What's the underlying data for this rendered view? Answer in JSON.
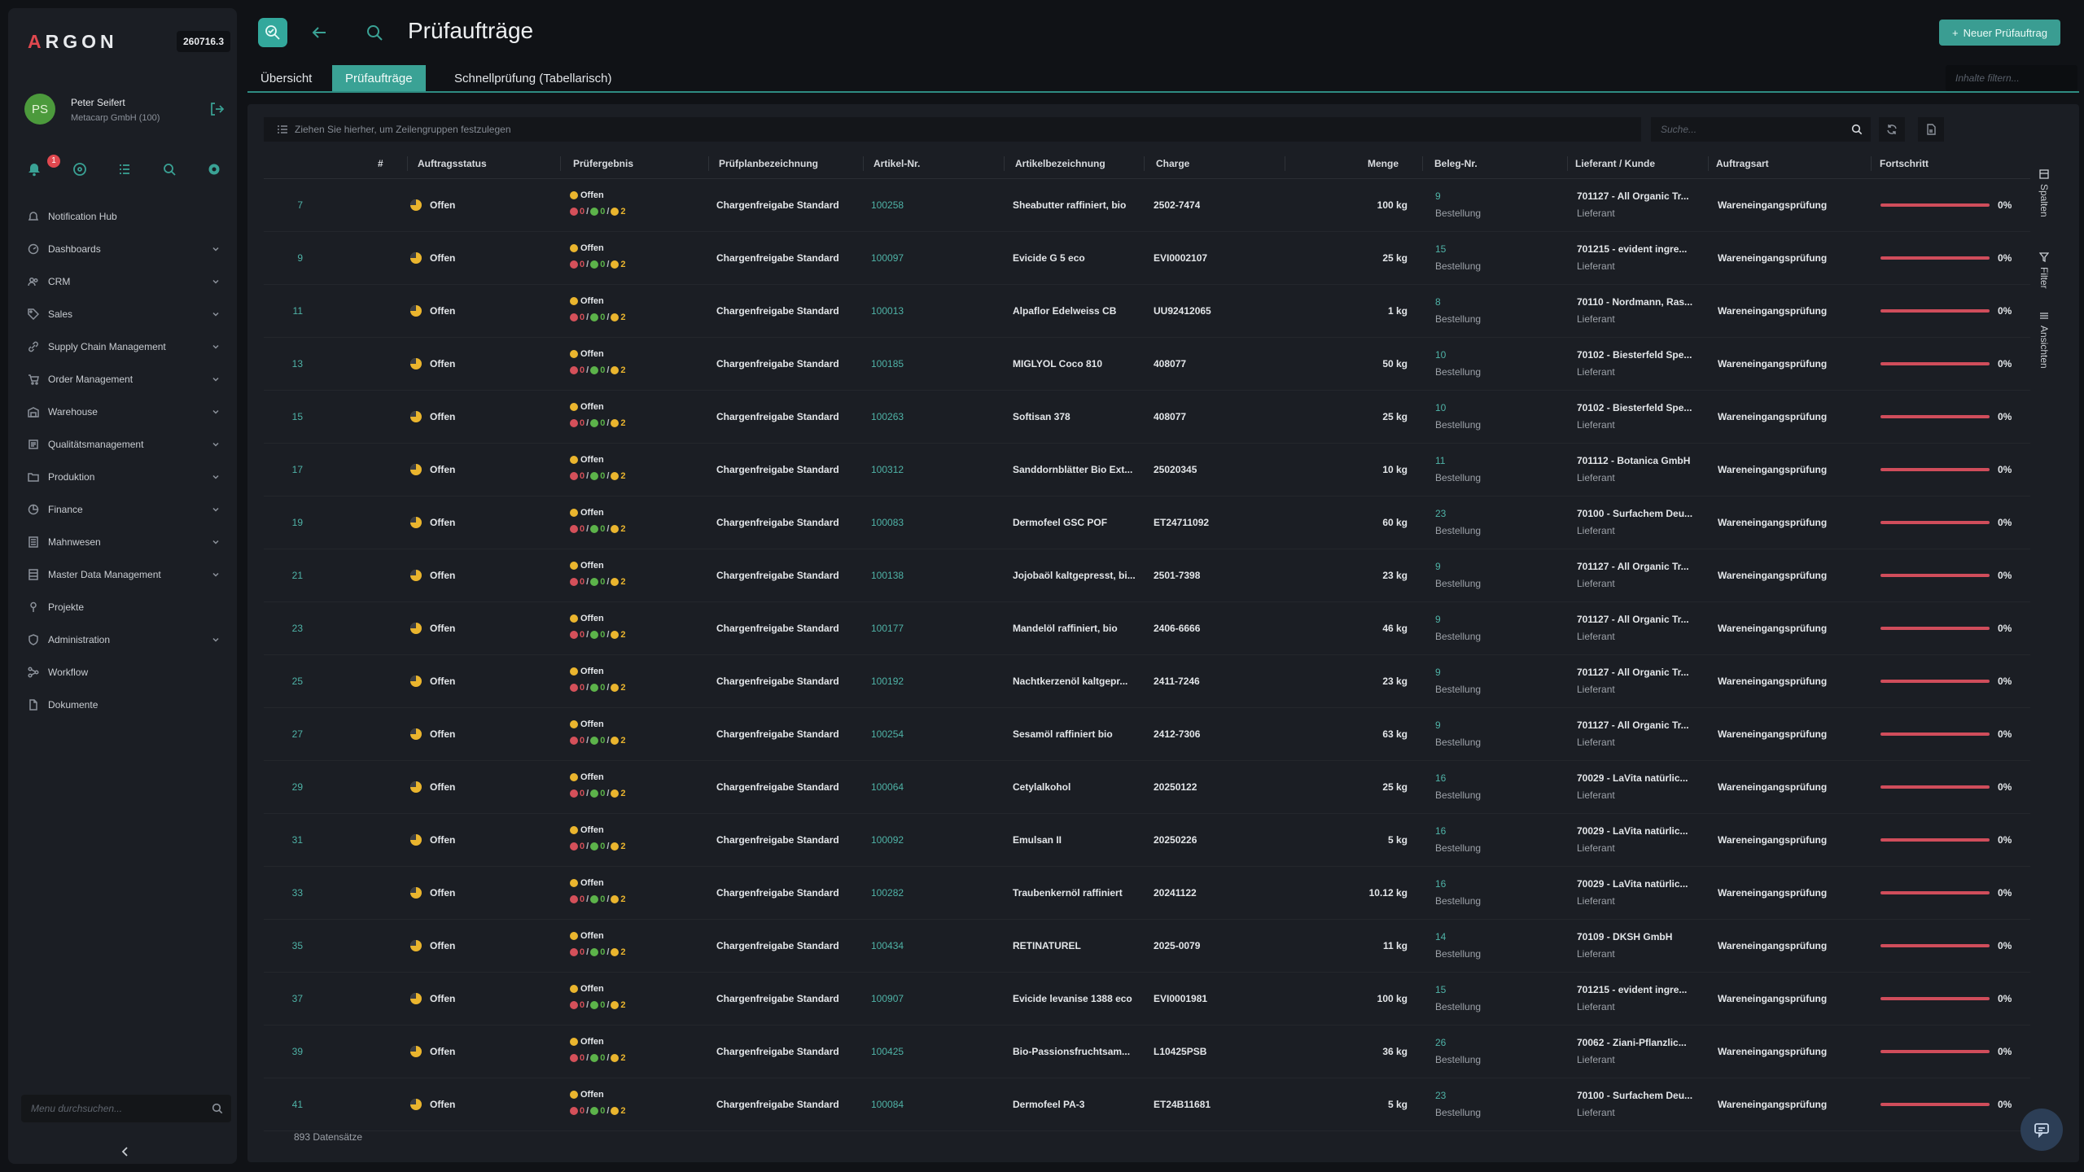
{
  "sidebar": {
    "logo": "RGON",
    "logo_a": "A",
    "version": "260716.3",
    "user": {
      "initials": "PS",
      "name": "Peter Seifert",
      "company": "Metacarp GmbH (100)"
    },
    "notification_count": "1",
    "items": [
      {
        "label": "Notification Hub",
        "icon": "bell-icon",
        "chevron": false
      },
      {
        "label": "Dashboards",
        "icon": "dashboard-icon",
        "chevron": true
      },
      {
        "label": "CRM",
        "icon": "users-icon",
        "chevron": true
      },
      {
        "label": "Sales",
        "icon": "tag-icon",
        "chevron": true
      },
      {
        "label": "Supply Chain Management",
        "icon": "link-icon",
        "chevron": true
      },
      {
        "label": "Order Management",
        "icon": "cart-icon",
        "chevron": true
      },
      {
        "label": "Warehouse",
        "icon": "warehouse-icon",
        "chevron": true
      },
      {
        "label": "Qualitätsmanagement",
        "icon": "quality-icon",
        "chevron": true
      },
      {
        "label": "Produktion",
        "icon": "folder-icon",
        "chevron": true
      },
      {
        "label": "Finance",
        "icon": "finance-icon",
        "chevron": true
      },
      {
        "label": "Mahnwesen",
        "icon": "archive-icon",
        "chevron": true
      },
      {
        "label": "Master Data Management",
        "icon": "database-icon",
        "chevron": true
      },
      {
        "label": "Projekte",
        "icon": "pin-icon",
        "chevron": false
      },
      {
        "label": "Administration",
        "icon": "shield-icon",
        "chevron": true
      },
      {
        "label": "Workflow",
        "icon": "workflow-icon",
        "chevron": false
      },
      {
        "label": "Dokumente",
        "icon": "document-icon",
        "chevron": false
      }
    ],
    "menu_search_placeholder": "Menu durchsuchen..."
  },
  "header": {
    "title": "Prüfaufträge",
    "new_button": "Neuer Prüfauftrag"
  },
  "tabs": [
    {
      "label": "Übersicht",
      "active": false
    },
    {
      "label": "Prüfaufträge",
      "active": true
    },
    {
      "label": "Schnellprüfung (Tabellarisch)",
      "active": false
    }
  ],
  "filter_placeholder": "Inhalte filtern...",
  "grid": {
    "group_hint": "Ziehen Sie hierher, um Zeilengruppen festzulegen",
    "search_placeholder": "Suche...",
    "columns": [
      "#",
      "Auftragsstatus",
      "Prüfergebnis",
      "Prüfplanbezeichnung",
      "Artikel-Nr.",
      "Artikelbezeichnung",
      "Charge",
      "Menge",
      "Beleg-Nr.",
      "Lieferant / Kunde",
      "Auftragsart",
      "Fortschritt"
    ],
    "side_tools": [
      "Spalten",
      "Filter",
      "Ansichten"
    ],
    "record_count": "893 Datensätze",
    "rows": [
      {
        "num": "7",
        "status": "Offen",
        "result": "Offen",
        "r": "0",
        "g": "0",
        "y": "2",
        "plan": "Chargenfreigabe Standard",
        "art": "100258",
        "artname": "Sheabutter raffiniert, bio",
        "charge": "2502-7474",
        "menge": "100 kg",
        "beleg": "9",
        "belegtype": "Bestellung",
        "lief": "701127 - All Organic Tr...",
        "lieftype": "Lieferant",
        "auftragsart": "Wareneingangsprüfung",
        "progress": "0%"
      },
      {
        "num": "9",
        "status": "Offen",
        "result": "Offen",
        "r": "0",
        "g": "0",
        "y": "2",
        "plan": "Chargenfreigabe Standard",
        "art": "100097",
        "artname": "Evicide G 5 eco",
        "charge": "EVI0002107",
        "menge": "25 kg",
        "beleg": "15",
        "belegtype": "Bestellung",
        "lief": "701215 - evident ingre...",
        "lieftype": "Lieferant",
        "auftragsart": "Wareneingangsprüfung",
        "progress": "0%"
      },
      {
        "num": "11",
        "status": "Offen",
        "result": "Offen",
        "r": "0",
        "g": "0",
        "y": "2",
        "plan": "Chargenfreigabe Standard",
        "art": "100013",
        "artname": "Alpaflor Edelweiss CB",
        "charge": "UU92412065",
        "menge": "1 kg",
        "beleg": "8",
        "belegtype": "Bestellung",
        "lief": "70110 - Nordmann, Ras...",
        "lieftype": "Lieferant",
        "auftragsart": "Wareneingangsprüfung",
        "progress": "0%"
      },
      {
        "num": "13",
        "status": "Offen",
        "result": "Offen",
        "r": "0",
        "g": "0",
        "y": "2",
        "plan": "Chargenfreigabe Standard",
        "art": "100185",
        "artname": "MIGLYOL Coco 810",
        "charge": "408077",
        "menge": "50 kg",
        "beleg": "10",
        "belegtype": "Bestellung",
        "lief": "70102 - Biesterfeld Spe...",
        "lieftype": "Lieferant",
        "auftragsart": "Wareneingangsprüfung",
        "progress": "0%"
      },
      {
        "num": "15",
        "status": "Offen",
        "result": "Offen",
        "r": "0",
        "g": "0",
        "y": "2",
        "plan": "Chargenfreigabe Standard",
        "art": "100263",
        "artname": "Softisan 378",
        "charge": "408077",
        "menge": "25 kg",
        "beleg": "10",
        "belegtype": "Bestellung",
        "lief": "70102 - Biesterfeld Spe...",
        "lieftype": "Lieferant",
        "auftragsart": "Wareneingangsprüfung",
        "progress": "0%"
      },
      {
        "num": "17",
        "status": "Offen",
        "result": "Offen",
        "r": "0",
        "g": "0",
        "y": "2",
        "plan": "Chargenfreigabe Standard",
        "art": "100312",
        "artname": "Sanddornblätter Bio Ext...",
        "charge": "25020345",
        "menge": "10 kg",
        "beleg": "11",
        "belegtype": "Bestellung",
        "lief": "701112 - Botanica GmbH",
        "lieftype": "Lieferant",
        "auftragsart": "Wareneingangsprüfung",
        "progress": "0%"
      },
      {
        "num": "19",
        "status": "Offen",
        "result": "Offen",
        "r": "0",
        "g": "0",
        "y": "2",
        "plan": "Chargenfreigabe Standard",
        "art": "100083",
        "artname": "Dermofeel GSC POF",
        "charge": "ET24711092",
        "menge": "60 kg",
        "beleg": "23",
        "belegtype": "Bestellung",
        "lief": "70100 - Surfachem Deu...",
        "lieftype": "Lieferant",
        "auftragsart": "Wareneingangsprüfung",
        "progress": "0%"
      },
      {
        "num": "21",
        "status": "Offen",
        "result": "Offen",
        "r": "0",
        "g": "0",
        "y": "2",
        "plan": "Chargenfreigabe Standard",
        "art": "100138",
        "artname": "Jojobaöl kaltgepresst, bi...",
        "charge": "2501-7398",
        "menge": "23 kg",
        "beleg": "9",
        "belegtype": "Bestellung",
        "lief": "701127 - All Organic Tr...",
        "lieftype": "Lieferant",
        "auftragsart": "Wareneingangsprüfung",
        "progress": "0%"
      },
      {
        "num": "23",
        "status": "Offen",
        "result": "Offen",
        "r": "0",
        "g": "0",
        "y": "2",
        "plan": "Chargenfreigabe Standard",
        "art": "100177",
        "artname": "Mandelöl raffiniert, bio",
        "charge": "2406-6666",
        "menge": "46 kg",
        "beleg": "9",
        "belegtype": "Bestellung",
        "lief": "701127 - All Organic Tr...",
        "lieftype": "Lieferant",
        "auftragsart": "Wareneingangsprüfung",
        "progress": "0%"
      },
      {
        "num": "25",
        "status": "Offen",
        "result": "Offen",
        "r": "0",
        "g": "0",
        "y": "2",
        "plan": "Chargenfreigabe Standard",
        "art": "100192",
        "artname": "Nachtkerzenöl kaltgepr...",
        "charge": "2411-7246",
        "menge": "23 kg",
        "beleg": "9",
        "belegtype": "Bestellung",
        "lief": "701127 - All Organic Tr...",
        "lieftype": "Lieferant",
        "auftragsart": "Wareneingangsprüfung",
        "progress": "0%"
      },
      {
        "num": "27",
        "status": "Offen",
        "result": "Offen",
        "r": "0",
        "g": "0",
        "y": "2",
        "plan": "Chargenfreigabe Standard",
        "art": "100254",
        "artname": "Sesamöl raffiniert bio",
        "charge": "2412-7306",
        "menge": "63 kg",
        "beleg": "9",
        "belegtype": "Bestellung",
        "lief": "701127 - All Organic Tr...",
        "lieftype": "Lieferant",
        "auftragsart": "Wareneingangsprüfung",
        "progress": "0%"
      },
      {
        "num": "29",
        "status": "Offen",
        "result": "Offen",
        "r": "0",
        "g": "0",
        "y": "2",
        "plan": "Chargenfreigabe Standard",
        "art": "100064",
        "artname": "Cetylalkohol",
        "charge": "20250122",
        "menge": "25 kg",
        "beleg": "16",
        "belegtype": "Bestellung",
        "lief": "70029 - LaVita natürlic...",
        "lieftype": "Lieferant",
        "auftragsart": "Wareneingangsprüfung",
        "progress": "0%"
      },
      {
        "num": "31",
        "status": "Offen",
        "result": "Offen",
        "r": "0",
        "g": "0",
        "y": "2",
        "plan": "Chargenfreigabe Standard",
        "art": "100092",
        "artname": "Emulsan II",
        "charge": "20250226",
        "menge": "5 kg",
        "beleg": "16",
        "belegtype": "Bestellung",
        "lief": "70029 - LaVita natürlic...",
        "lieftype": "Lieferant",
        "auftragsart": "Wareneingangsprüfung",
        "progress": "0%"
      },
      {
        "num": "33",
        "status": "Offen",
        "result": "Offen",
        "r": "0",
        "g": "0",
        "y": "2",
        "plan": "Chargenfreigabe Standard",
        "art": "100282",
        "artname": "Traubenkernöl raffiniert",
        "charge": "20241122",
        "menge": "10.12 kg",
        "beleg": "16",
        "belegtype": "Bestellung",
        "lief": "70029 - LaVita natürlic...",
        "lieftype": "Lieferant",
        "auftragsart": "Wareneingangsprüfung",
        "progress": "0%"
      },
      {
        "num": "35",
        "status": "Offen",
        "result": "Offen",
        "r": "0",
        "g": "0",
        "y": "2",
        "plan": "Chargenfreigabe Standard",
        "art": "100434",
        "artname": "RETINATUREL",
        "charge": "2025-0079",
        "menge": "11 kg",
        "beleg": "14",
        "belegtype": "Bestellung",
        "lief": "70109 - DKSH GmbH",
        "lieftype": "Lieferant",
        "auftragsart": "Wareneingangsprüfung",
        "progress": "0%"
      },
      {
        "num": "37",
        "status": "Offen",
        "result": "Offen",
        "r": "0",
        "g": "0",
        "y": "2",
        "plan": "Chargenfreigabe Standard",
        "art": "100907",
        "artname": "Evicide levanise 1388 eco",
        "charge": "EVI0001981",
        "menge": "100 kg",
        "beleg": "15",
        "belegtype": "Bestellung",
        "lief": "701215 - evident ingre...",
        "lieftype": "Lieferant",
        "auftragsart": "Wareneingangsprüfung",
        "progress": "0%"
      },
      {
        "num": "39",
        "status": "Offen",
        "result": "Offen",
        "r": "0",
        "g": "0",
        "y": "2",
        "plan": "Chargenfreigabe Standard",
        "art": "100425",
        "artname": "Bio-Passionsfruchtsam...",
        "charge": "L10425PSB",
        "menge": "36 kg",
        "beleg": "26",
        "belegtype": "Bestellung",
        "lief": "70062 - Ziani-Pflanzlic...",
        "lieftype": "Lieferant",
        "auftragsart": "Wareneingangsprüfung",
        "progress": "0%"
      },
      {
        "num": "41",
        "status": "Offen",
        "result": "Offen",
        "r": "0",
        "g": "0",
        "y": "2",
        "plan": "Chargenfreigabe Standard",
        "art": "100084",
        "artname": "Dermofeel PA-3",
        "charge": "ET24B11681",
        "menge": "5 kg",
        "beleg": "23",
        "belegtype": "Bestellung",
        "lief": "70100 - Surfachem Deu...",
        "lieftype": "Lieferant",
        "auftragsart": "Wareneingangsprüfung",
        "progress": "0%"
      }
    ]
  },
  "colors": {
    "accent": "#3aa295",
    "link": "#4fb3a7",
    "progress": "#d04d5b",
    "bg": "#101216",
    "panel": "#1b1e24"
  }
}
